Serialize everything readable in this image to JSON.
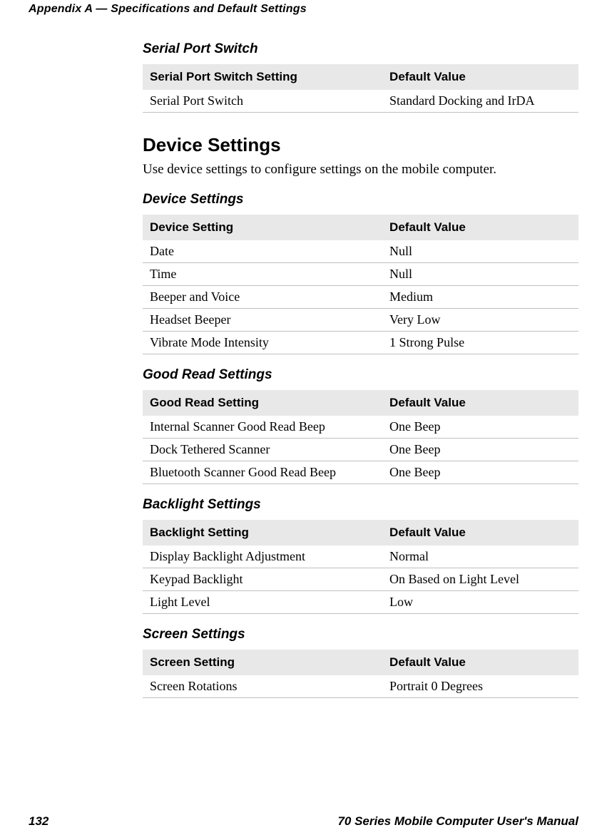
{
  "header": "Appendix A — Specifications and Default Settings",
  "footer": {
    "page_number": "132",
    "manual_title": "70 Series Mobile Computer User's Manual"
  },
  "sections": {
    "serial_port_switch": {
      "heading": "Serial Port Switch",
      "col1": "Serial Port Switch Setting",
      "col2": "Default Value",
      "rows": [
        {
          "setting": "Serial Port Switch",
          "value": "Standard Docking and IrDA"
        }
      ]
    },
    "device_settings_intro": {
      "heading": "Device Settings",
      "body": "Use device settings to configure settings on the mobile computer."
    },
    "device_settings": {
      "heading": "Device Settings",
      "col1": "Device Setting",
      "col2": "Default Value",
      "rows": [
        {
          "setting": "Date",
          "value": "Null"
        },
        {
          "setting": "Time",
          "value": "Null"
        },
        {
          "setting": "Beeper and Voice",
          "value": "Medium"
        },
        {
          "setting": "Headset Beeper",
          "value": "Very Low"
        },
        {
          "setting": "Vibrate Mode Intensity",
          "value": "1 Strong Pulse"
        }
      ]
    },
    "good_read": {
      "heading": "Good Read Settings",
      "col1": "Good Read Setting",
      "col2": "Default Value",
      "rows": [
        {
          "setting": "Internal Scanner Good Read Beep",
          "value": "One Beep"
        },
        {
          "setting": "Dock Tethered Scanner",
          "value": "One Beep"
        },
        {
          "setting": "Bluetooth Scanner Good Read Beep",
          "value": "One Beep"
        }
      ]
    },
    "backlight": {
      "heading": "Backlight Settings",
      "col1": "Backlight Setting",
      "col2": "Default Value",
      "rows": [
        {
          "setting": "Display Backlight Adjustment",
          "value": "Normal"
        },
        {
          "setting": "Keypad Backlight",
          "value": "On Based on Light Level"
        },
        {
          "setting": "Light Level",
          "value": "Low"
        }
      ]
    },
    "screen": {
      "heading": "Screen Settings",
      "col1": "Screen Setting",
      "col2": "Default Value",
      "rows": [
        {
          "setting": "Screen Rotations",
          "value": "Portrait 0 Degrees"
        }
      ]
    }
  }
}
